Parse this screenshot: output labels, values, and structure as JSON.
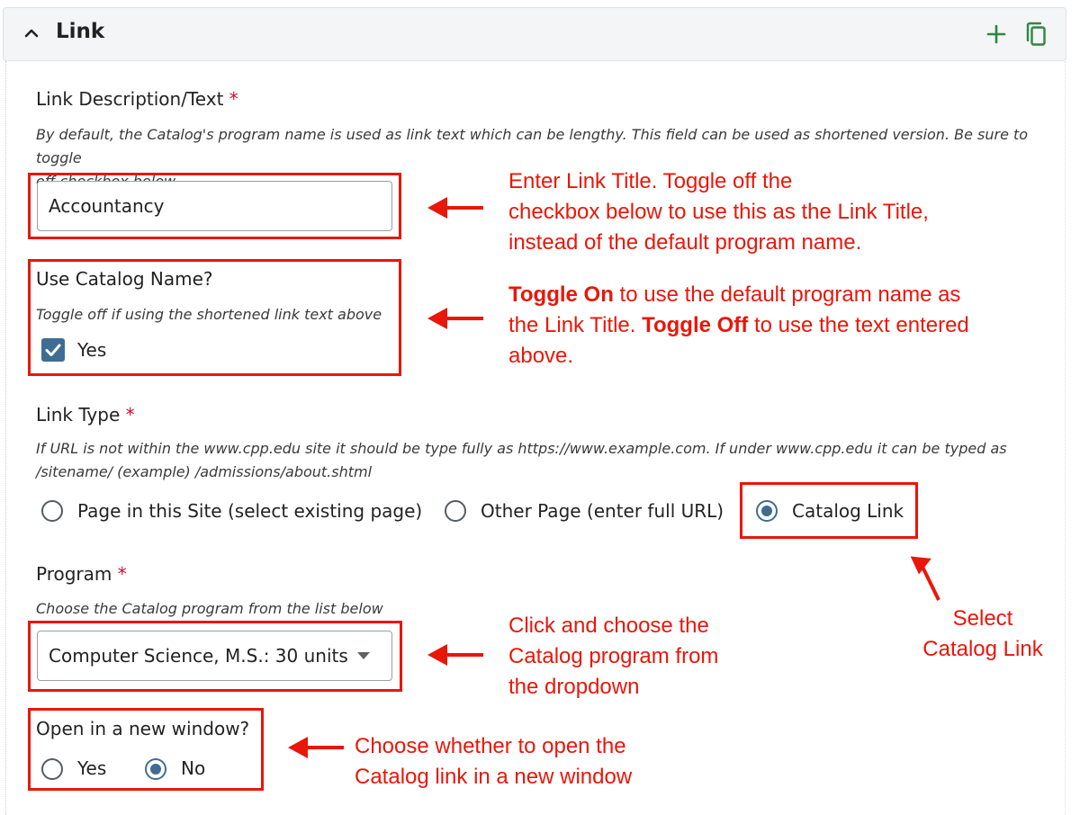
{
  "header": {
    "title": "Link"
  },
  "link_text": {
    "label": "Link Description/Text",
    "required_mark": "*",
    "help_line1": "By default, the Catalog's program name is used as link text which can be lengthy. This field can be used as shortened version. Be sure to toggle",
    "help_line2": "off checkbox below.",
    "value": "Accountancy"
  },
  "use_catalog": {
    "label": "Use Catalog Name?",
    "help": "Toggle off if using the shortened link text above",
    "checkbox_label": "Yes",
    "checked": true
  },
  "link_type": {
    "label": "Link Type",
    "required_mark": "*",
    "help_line1": "If URL is not within the www.cpp.edu site it should be type fully as https://www.example.com. If under www.cpp.edu it can be typed as",
    "help_line2": "/sitename/ (example) /admissions/about.shtml",
    "options": [
      "Page in this Site (select existing page)",
      "Other Page (enter full URL)",
      "Catalog Link"
    ],
    "selected": "Catalog Link"
  },
  "program": {
    "label": "Program",
    "required_mark": "*",
    "help": "Choose the Catalog program from the list below",
    "selected": "Computer Science, M.S.: 30 units"
  },
  "new_window": {
    "label": "Open in a new window?",
    "options": [
      "Yes",
      "No"
    ],
    "selected": "No"
  },
  "annotations": {
    "a1_l1": "Enter Link Title. Toggle off the",
    "a1_l2": "checkbox below to use this as the Link Title,",
    "a1_l3": "instead of the default program name.",
    "a2_b1": "Toggle On",
    "a2_l1": " to use the default program name as",
    "a2_l2a": "the Link Title. ",
    "a2_b2": "Toggle Off",
    "a2_l2b": " to use the text entered",
    "a2_l3": "above.",
    "a3_l1": "Select",
    "a3_l2": "Catalog Link",
    "a4_l1": "Click and choose the",
    "a4_l2": "Catalog program from",
    "a4_l3": "the dropdown",
    "a5_l1": "Choose whether to open the",
    "a5_l2": "Catalog link in a new window"
  },
  "colors": {
    "annotation": "#e8170a",
    "accent": "#3f6d92",
    "header_icons": "#2e8540",
    "required": "#c8102e"
  },
  "icons": [
    "chevron-up-icon",
    "plus-icon",
    "copy-icon",
    "checkmark-icon",
    "caret-down-icon",
    "arrow-left-icon",
    "arrow-up-icon"
  ]
}
